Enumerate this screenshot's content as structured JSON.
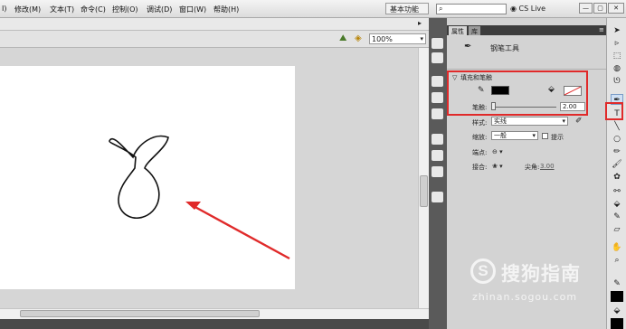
{
  "menubar": {
    "items": [
      "I)",
      "修改(M)",
      "文本(T)",
      "命令(C)",
      "控制(O)",
      "调试(D)",
      "窗口(W)",
      "帮助(H)"
    ],
    "workspace": "基本功能",
    "search_placeholder": "",
    "cs_live": "CS Live"
  },
  "edit_bar": {
    "zoom": "100%"
  },
  "panel": {
    "tabs": [
      "属性",
      "库"
    ],
    "tool_name": "钢笔工具",
    "section_title": "填充和笔触",
    "stroke_label": "笔触:",
    "stroke_value": "2.00",
    "style_label": "样式:",
    "style_value": "实线",
    "scale_label": "缩放:",
    "scale_value": "一般",
    "hint_label": "提示",
    "cap_label": "端点:",
    "join_label": "接合:",
    "miter_label": "尖角:",
    "miter_value": "3.00"
  },
  "colors": {
    "stroke": "#000000",
    "annotation": "#e02a2a",
    "stage": "#ffffff"
  },
  "watermark": {
    "brand": "搜狗指南",
    "url": "zhinan.sogou.com"
  },
  "icons": [
    "pen-icon",
    "selection-icon",
    "subselect-icon",
    "free-transform-icon",
    "lasso-icon",
    "line-icon",
    "oval-icon",
    "pencil-icon",
    "brush-icon",
    "bucket-icon",
    "eyedropper-icon",
    "eraser-icon",
    "hand-icon",
    "zoom-icon"
  ]
}
